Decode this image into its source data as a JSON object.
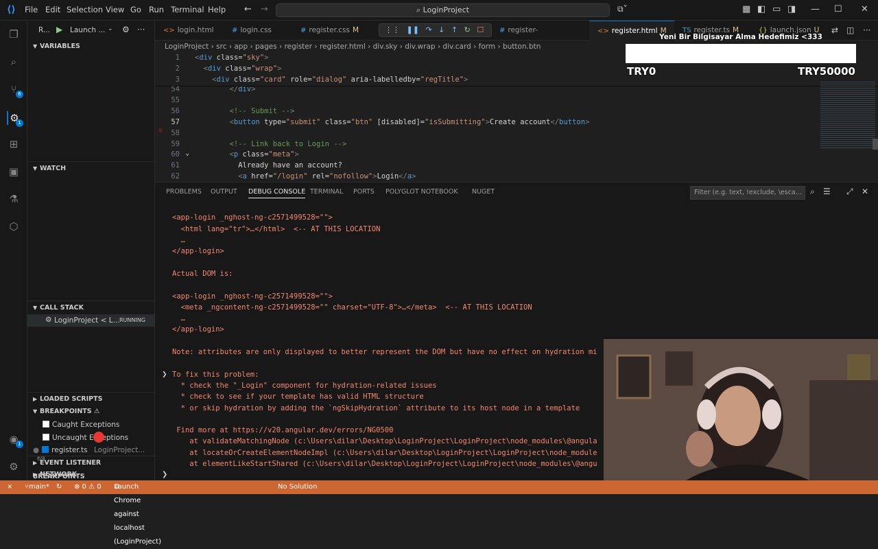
{
  "titlebar": {
    "menus": [
      "File",
      "Edit",
      "Selection",
      "View",
      "Go",
      "Run",
      "Terminal",
      "Help"
    ],
    "search": "LoginProject"
  },
  "debug_toolbar": {
    "config": "Launch ...",
    "run_short": "R..."
  },
  "sidebar": {
    "variables": "VARIABLES",
    "watch": "WATCH",
    "call_stack": "CALL STACK",
    "call_stack_item": "LoginProject < L...",
    "call_stack_status": "RUNNING",
    "loaded_scripts": "LOADED SCRIPTS",
    "breakpoints": "BREAKPOINTS",
    "bp_items": [
      {
        "label": "Caught Exceptions",
        "checked": false
      },
      {
        "label": "Uncaught Exceptions",
        "checked": false
      },
      {
        "label": "register.ts",
        "checked": true,
        "path": "LoginProject...",
        "line": "69"
      }
    ],
    "event_listener": "EVENT LISTENER BREAKPOINTS",
    "network": "NETWORK"
  },
  "tabs": [
    {
      "label": "login.html",
      "kind": "html",
      "mod": ""
    },
    {
      "label": "login.css",
      "kind": "css",
      "mod": ""
    },
    {
      "label": "register.css",
      "kind": "css",
      "mod": "M"
    },
    {
      "label": "register-successful.css",
      "kind": "css",
      "mod": ""
    },
    {
      "label": "register.html",
      "kind": "html",
      "mod": "M",
      "active": true
    },
    {
      "label": "register.ts",
      "kind": "ts",
      "mod": "M"
    },
    {
      "label": "launch.json",
      "kind": "json",
      "mod": "U"
    }
  ],
  "breadcrumb": [
    "LoginProject",
    "src",
    "app",
    "pages",
    "register",
    "register.html",
    "div.sky",
    "div.wrap",
    "div.card",
    "form",
    "button.btn"
  ],
  "editor": {
    "lines": [
      {
        "n": "1",
        "code": "<div class=\"sky\">"
      },
      {
        "n": "2",
        "code": "  <div class=\"wrap\">"
      },
      {
        "n": "3",
        "code": "    <div class=\"card\" role=\"dialog\" aria-labelledby=\"regTitle\">"
      },
      {
        "n": "54",
        "code": "        </div>"
      },
      {
        "n": "55",
        "code": ""
      },
      {
        "n": "56",
        "code": "        <!-- Submit -->"
      },
      {
        "n": "57",
        "code": "        <button type=\"submit\" class=\"btn\" [disabled]=\"isSubmitting\">Create account</button>"
      },
      {
        "n": "58",
        "code": ""
      },
      {
        "n": "59",
        "code": "        <!-- Link back to Login -->"
      },
      {
        "n": "60",
        "code": "        <p class=\"meta\">"
      },
      {
        "n": "61",
        "code": "          Already have an account?"
      },
      {
        "n": "62",
        "code": "          <a href=\"/login\" rel=\"nofollow\">Login</a>"
      }
    ]
  },
  "panel": {
    "tabs": [
      "PROBLEMS",
      "OUTPUT",
      "DEBUG CONSOLE",
      "TERMINAL",
      "PORTS",
      "POLYGLOT NOTEBOOK",
      "NUGET"
    ],
    "active_tab": "DEBUG CONSOLE",
    "filter_placeholder": "Filter (e.g. text, !exclude, \\esca...",
    "console": [
      "<app-login _nghost-ng-c2571499528=\"\">",
      "  <html lang=\"tr\">…</html>  <-- AT THIS LOCATION",
      "  …",
      "</app-login>",
      "",
      "Actual DOM is:",
      "",
      "<app-login _nghost-ng-c2571499528=\"\">",
      "  <meta _ngcontent-ng-c2571499528=\"\" charset=\"UTF-8\">…</meta>  <-- AT THIS LOCATION",
      "  …",
      "</app-login>",
      "",
      "Note: attributes are only displayed to better represent the DOM but have no effect on hydration mi",
      "",
      "To fix this problem:",
      "  * check the \"_Login\" component for hydration-related issues",
      "  * check to see if your template has valid HTML structure",
      "  * or skip hydration by adding the `ngSkipHydration` attribute to its host node in a template",
      "",
      " Find more at https://v20.angular.dev/errors/NG0500",
      "    at validateMatchingNode (c:\\Users\\dilar\\Desktop\\LoginProject\\LoginProject\\node_modules\\@angula",
      "    at locateOrCreateElementNodeImpl (c:\\Users\\dilar\\Desktop\\LoginProject\\LoginProject\\node_module",
      "    at elementLikeStartShared (c:\\Users\\dilar\\Desktop\\LoginProject\\LoginProject\\node_modules\\@angu"
    ]
  },
  "overlay": {
    "goal_title": "Yeni Bir Bilgisayar Alma Hedefimiz <333",
    "goal_current": "TRY0",
    "goal_target": "TRY50000",
    "goal_progress": 0
  },
  "statusbar": {
    "branch": "main*",
    "problems": "⊗ 0 ⚠ 0",
    "launch": "Launch Chrome against localhost (LoginProject)",
    "solution": "No Solution"
  },
  "colors": {
    "accent": "#0078d4",
    "status": "#cc6633",
    "error_text": "#f48771"
  }
}
